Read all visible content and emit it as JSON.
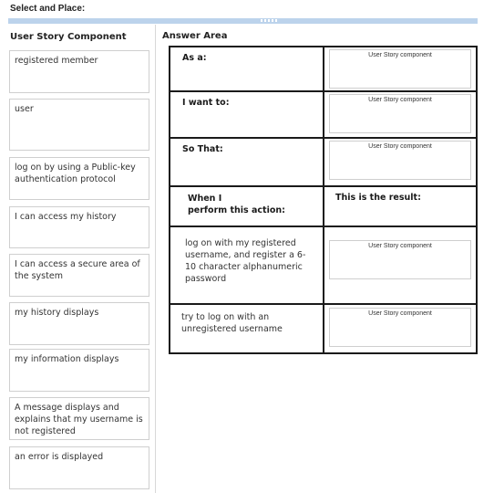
{
  "title": "Select and Place:",
  "left_panel": {
    "heading": "User Story Component",
    "tiles": [
      {
        "label": "registered member"
      },
      {
        "label": "user"
      },
      {
        "label": "log on by using a Public-key authentication protocol"
      },
      {
        "label": "I can access my history"
      },
      {
        "label": "I can access a secure area of the system"
      },
      {
        "label": "my history displays"
      },
      {
        "label": "my information displays"
      },
      {
        "label": "A message displays and explains that my username is not registered"
      },
      {
        "label": "an error is displayed"
      }
    ]
  },
  "answer_area": {
    "heading": "Answer Area",
    "slot_placeholder": "User Story component",
    "rows": [
      {
        "label": "As a:"
      },
      {
        "label": "I want to:"
      },
      {
        "label": "So That:"
      }
    ],
    "scenario_header": {
      "action": "When I\nperform this action:",
      "result": "This is the result:"
    },
    "scenarios": [
      {
        "action": "log on with my registered username, and register a 6-10 character alphanumeric password"
      },
      {
        "action": "try to log on with an unregistered username"
      }
    ]
  }
}
